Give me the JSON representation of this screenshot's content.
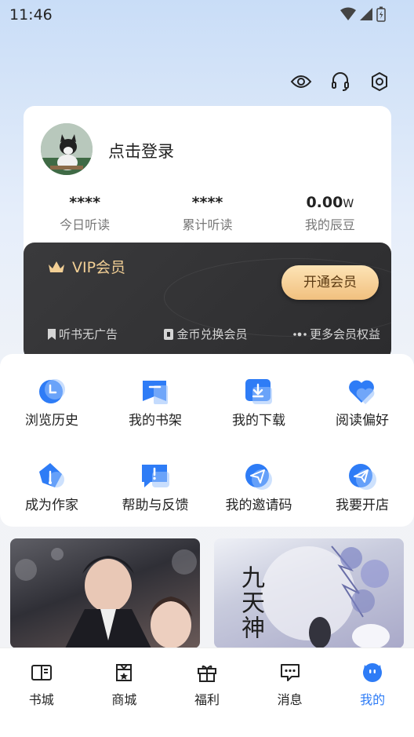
{
  "status_bar": {
    "time": "11:46"
  },
  "header_icons": [
    "eye-icon",
    "headset-icon",
    "settings-icon"
  ],
  "profile": {
    "login_prompt": "点击登录",
    "stats": [
      {
        "value": "****",
        "unit": "",
        "label": "今日听读"
      },
      {
        "value": "****",
        "unit": "",
        "label": "累计听读"
      },
      {
        "value": "0.00",
        "unit": "W",
        "label": "我的辰豆"
      }
    ]
  },
  "vip": {
    "title": "VIP会员",
    "button": "开通会员",
    "perks": [
      {
        "icon": "bookmark-icon",
        "label": "听书无广告"
      },
      {
        "icon": "coin-icon",
        "label": "金币兑换会员"
      },
      {
        "icon": "more-dots-icon",
        "label": "更多会员权益"
      }
    ],
    "colors": {
      "gold": "#f2cf95",
      "card": "#2c2c2e"
    }
  },
  "menu": [
    {
      "icon": "history-clock-icon",
      "label": "浏览历史"
    },
    {
      "icon": "bookshelf-icon",
      "label": "我的书架"
    },
    {
      "icon": "download-icon",
      "label": "我的下载"
    },
    {
      "icon": "heart-icon",
      "label": "阅读偏好"
    },
    {
      "icon": "pen-nib-icon",
      "label": "成为作家"
    },
    {
      "icon": "feedback-icon",
      "label": "帮助与反馈"
    },
    {
      "icon": "invite-code-icon",
      "label": "我的邀请码"
    },
    {
      "icon": "open-shop-icon",
      "label": "我要开店"
    }
  ],
  "banners": [
    {
      "title": ""
    },
    {
      "title": "九天神"
    }
  ],
  "tabs": [
    {
      "icon": "book-open-icon",
      "label": "书城",
      "active": false
    },
    {
      "icon": "shop-bag-icon",
      "label": "商城",
      "active": false
    },
    {
      "icon": "gift-icon",
      "label": "福利",
      "active": false
    },
    {
      "icon": "message-icon",
      "label": "消息",
      "active": false
    },
    {
      "icon": "profile-face-icon",
      "label": "我的",
      "active": true
    }
  ],
  "accent_color": "#2e7cf6"
}
